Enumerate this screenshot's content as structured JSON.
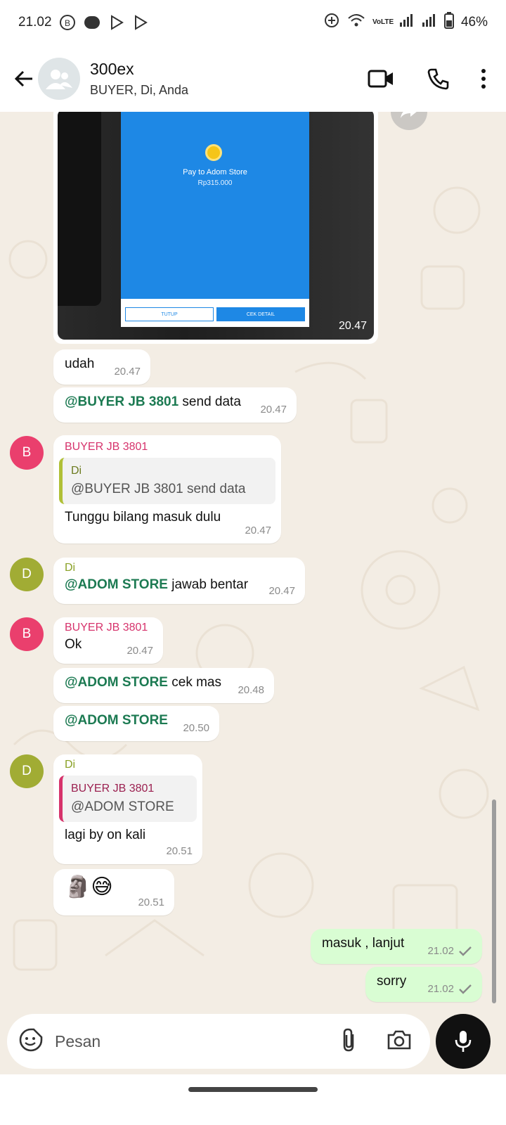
{
  "status_bar": {
    "time": "21.02",
    "battery": "46%",
    "net_label": "VoLTE"
  },
  "header": {
    "name": "300ex",
    "members": "BUYER, Di, Anda"
  },
  "image_message": {
    "pay_title": "Pay to Adom Store",
    "pay_amount": "Rp315.000",
    "btn_close": "TUTUP",
    "btn_detail": "CEK DETAIL",
    "time": "20.47"
  },
  "messages": [
    {
      "text": "udah",
      "time": "20.47"
    },
    {
      "mention": "@BUYER JB 3801",
      "text": " send data",
      "time": "20.47"
    },
    {
      "sender": "BUYER JB 3801",
      "quote_sender": "Di",
      "quote_text": "@BUYER JB 3801  send data",
      "text": "Tunggu bilang masuk dulu",
      "time": "20.47"
    },
    {
      "sender": "Di",
      "mention": "@ADOM STORE",
      "text": " jawab bentar",
      "time": "20.47"
    },
    {
      "sender": "BUYER JB 3801",
      "text": "Ok",
      "time": "20.47"
    },
    {
      "mention": "@ADOM STORE",
      "text": " cek mas",
      "time": "20.48"
    },
    {
      "mention": "@ADOM STORE",
      "time": "20.50"
    },
    {
      "sender": "Di",
      "quote_sender": "BUYER JB 3801",
      "quote_text": "@ADOM STORE",
      "text": "lagi by on kali",
      "time": "20.51"
    },
    {
      "emoji": "🗿😅",
      "time": "20.51"
    },
    {
      "text": "masuk , lanjut",
      "time": "21.02"
    },
    {
      "text": "sorry",
      "time": "21.02"
    }
  ],
  "avatars": {
    "buyer": "B",
    "di": "D"
  },
  "composer": {
    "placeholder": "Pesan"
  },
  "colors": {
    "outgoing": "#d9fdd3",
    "mention": "#1c7a52",
    "buyer": "#ea3f6d",
    "di": "#a1ac34"
  }
}
